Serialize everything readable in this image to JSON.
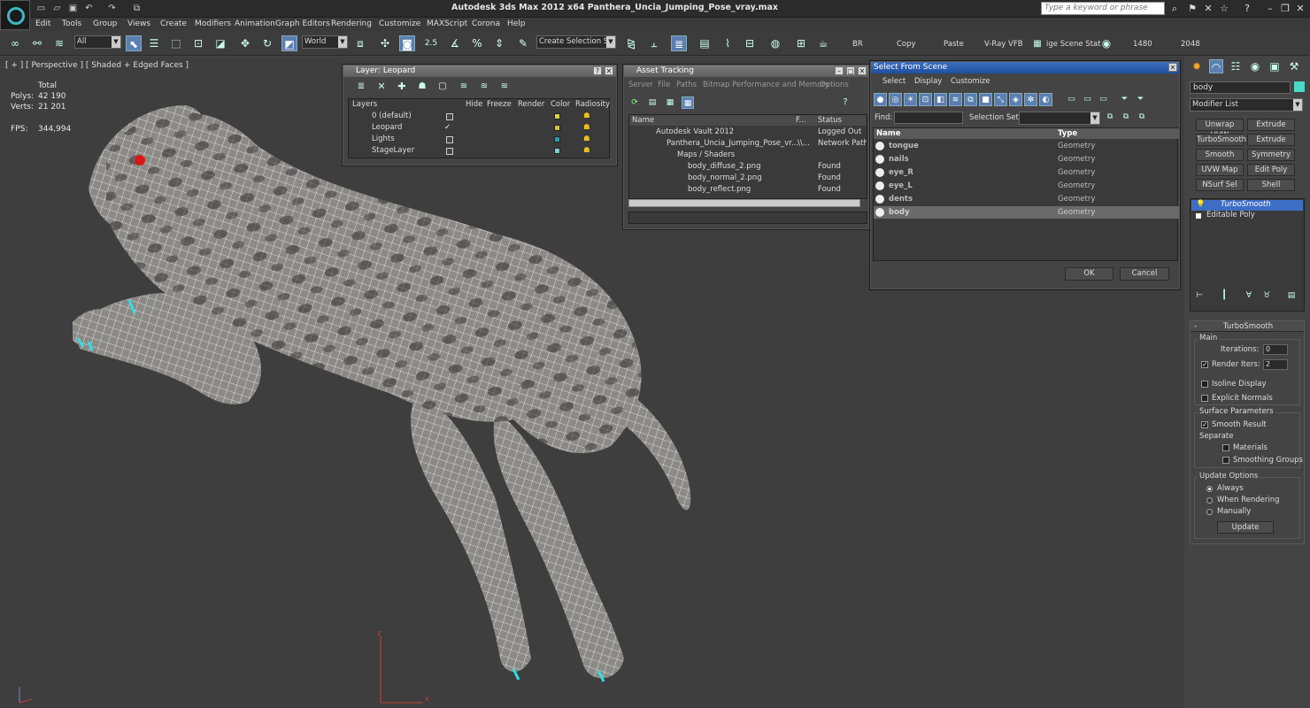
{
  "app": {
    "title": "Autodesk 3ds Max  2012 x64    Panthera_Uncia_Jumping_Pose_vray.max",
    "search_placeholder": "Type a keyword or phrase"
  },
  "menu": [
    "Edit",
    "Tools",
    "Group",
    "Views",
    "Create",
    "Modifiers",
    "Animation",
    "Graph Editors",
    "Rendering",
    "Customize",
    "MAXScript",
    "Corona",
    "Help"
  ],
  "toolbar": {
    "filter": "All",
    "coord": "World",
    "snap_num": "2.5",
    "selection_set": "Create Selection Se",
    "br": "BR",
    "copy": "Copy",
    "paste": "Paste",
    "vfb": "V-Ray VFB",
    "scene_state": "ige Scene Stat",
    "width": "1480",
    "height": "2048"
  },
  "viewport": {
    "label": "[ + ] [ Perspective ] [ Shaded + Edged Faces ]",
    "total_label": "Total",
    "polys_label": "Polys:",
    "polys": "42 190",
    "verts_label": "Verts:",
    "verts": "21 201",
    "fps_label": "FPS:",
    "fps": "344,994",
    "axis_x": "x",
    "axis_z": "z"
  },
  "layer_panel": {
    "title": "Layer: Leopard",
    "headers": [
      "Layers",
      "Hide",
      "Freeze",
      "Render",
      "Color",
      "Radiosity"
    ],
    "rows": [
      {
        "name": "0 (default)",
        "color": "#d8d838"
      },
      {
        "name": "Leopard",
        "color": "#c8c830"
      },
      {
        "name": "Lights",
        "color": "#2a9ab0"
      },
      {
        "name": "StageLayer",
        "color": "#7ad0c8"
      }
    ]
  },
  "asset_panel": {
    "title": "Asset Tracking",
    "menu": [
      "Server",
      "File",
      "Paths",
      "Bitmap Performance and Memory",
      "Options"
    ],
    "headers": [
      "Name",
      "F...",
      "Status"
    ],
    "rows": [
      {
        "name": "Autodesk Vault 2012",
        "f": "",
        "status": "Logged Out"
      },
      {
        "name": "Panthera_Uncia_Jumping_Pose_vr...",
        "f": "\\\\...",
        "status": "Network Path"
      },
      {
        "name": "Maps / Shaders",
        "f": "",
        "status": ""
      },
      {
        "name": "body_diffuse_2.png",
        "f": "",
        "status": "Found"
      },
      {
        "name": "body_normal_2.png",
        "f": "",
        "status": "Found"
      },
      {
        "name": "body_reflect.png",
        "f": "",
        "status": "Found"
      }
    ]
  },
  "select_panel": {
    "title": "Select From Scene",
    "menu": [
      "Select",
      "Display",
      "Customize"
    ],
    "find_label": "Find:",
    "selset_label": "Selection Set:",
    "headers": [
      "Name",
      "Type"
    ],
    "rows": [
      {
        "name": "tongue",
        "type": "Geometry"
      },
      {
        "name": "nails",
        "type": "Geometry"
      },
      {
        "name": "eye_R",
        "type": "Geometry"
      },
      {
        "name": "eye_L",
        "type": "Geometry"
      },
      {
        "name": "dents",
        "type": "Geometry"
      },
      {
        "name": "body",
        "type": "Geometry"
      }
    ],
    "ok": "OK",
    "cancel": "Cancel"
  },
  "command_panel": {
    "object_name": "body",
    "modifier_list": "Modifier List",
    "buttons": [
      "Unwrap UVW",
      "Extrude",
      "TurboSmooth",
      "Extrude",
      "Smooth",
      "Symmetry",
      "UVW Map",
      "Edit Poly",
      "NSurf Sel",
      "Shell"
    ],
    "stack": [
      "TurboSmooth",
      "Editable Poly"
    ],
    "rollout_title": "TurboSmooth",
    "main_label": "Main",
    "iterations_label": "Iterations:",
    "iterations": "0",
    "render_iters_label": "Render Iters:",
    "render_iters": "2",
    "isoline": "Isoline Display",
    "explicit_normals": "Explicit Normals",
    "surface_params": "Surface Parameters",
    "smooth_result": "Smooth Result",
    "separate": "Separate",
    "materials": "Materials",
    "smoothing_groups": "Smoothing Groups",
    "update_options": "Update Options",
    "always": "Always",
    "when_rendering": "When Rendering",
    "manually": "Manually",
    "update": "Update"
  }
}
